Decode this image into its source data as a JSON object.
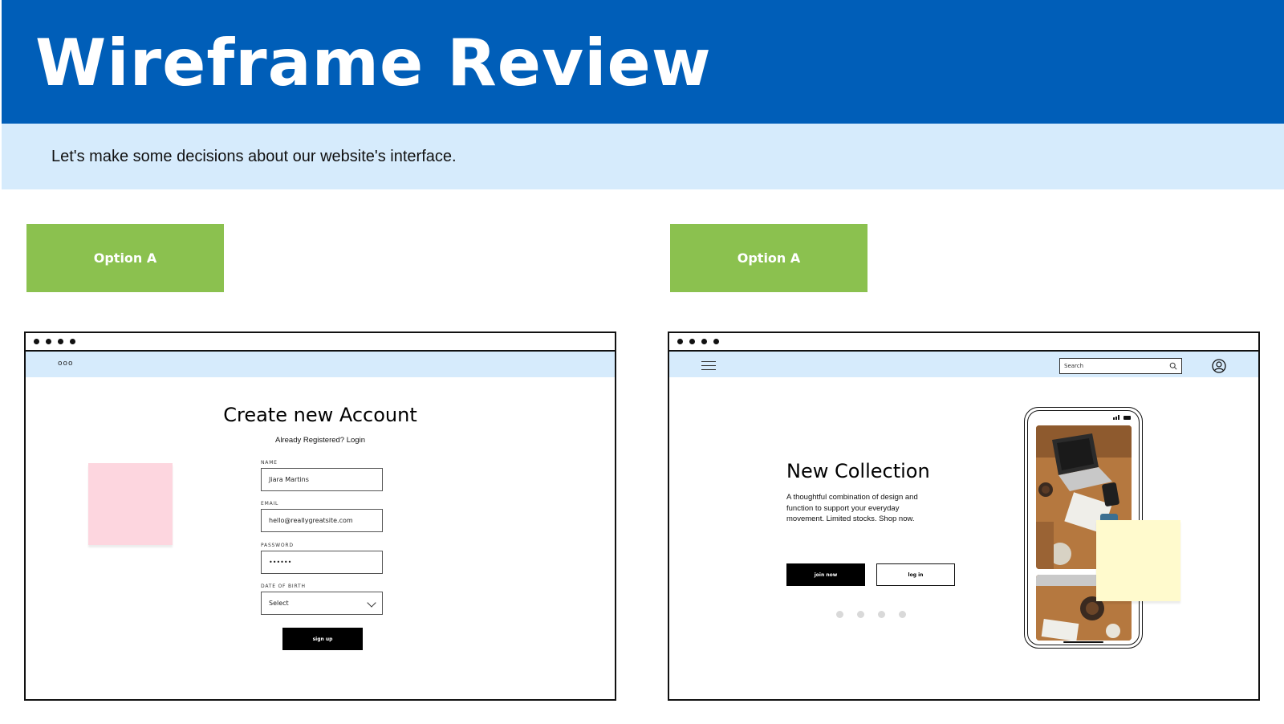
{
  "header": {
    "title": "Wireframe Review",
    "subtitle": "Let's make some decisions about our website's interface."
  },
  "options": {
    "left_label": "Option A",
    "right_label": "Option A"
  },
  "signup_wireframe": {
    "nav_logo": "ooo",
    "title": "Create new Account",
    "subtitle": "Already Registered? Login",
    "fields": {
      "name_label": "NAME",
      "name_value": "Jiara Martins",
      "email_label": "EMAIL",
      "email_value": "hello@reallygreatsite.com",
      "password_label": "PASSWORD",
      "password_value": "••••••",
      "dob_label": "DATE OF BIRTH",
      "dob_value": "Select"
    },
    "signup_button": "sign up"
  },
  "landing_wireframe": {
    "search_placeholder": "Search",
    "hero_title": "New Collection",
    "hero_description": "A thoughtful combination of design and function to support your everyday movement. Limited stocks. Shop now.",
    "join_button": "join now",
    "login_button": "log in",
    "carousel_dot_count": 4
  },
  "colors": {
    "header_blue": "#005eb8",
    "light_blue": "#d6ebfc",
    "option_green": "#8bc14f",
    "sticky_pink": "#fdd6df",
    "sticky_yellow": "#fffacd"
  },
  "icons": [
    "hamburger-menu-icon",
    "search-icon",
    "user-account-icon",
    "window-dots-icon"
  ]
}
